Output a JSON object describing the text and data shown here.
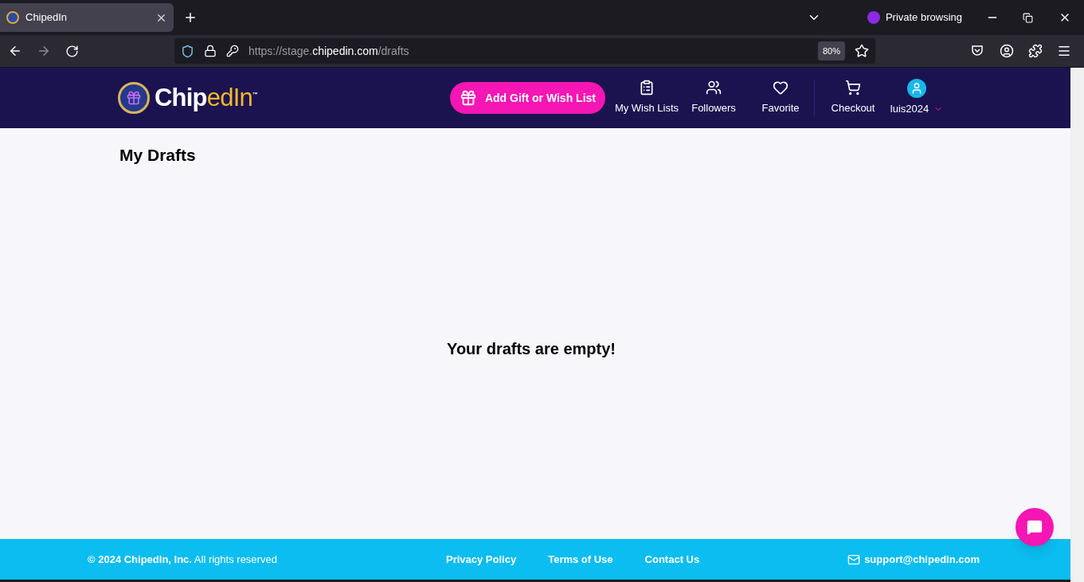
{
  "browser": {
    "tab": {
      "title": "ChipedIn",
      "selected": true
    },
    "private_label": "Private browsing",
    "url": {
      "prefix": "https://stage.",
      "domain": "chipedin.com",
      "path": "/drafts"
    },
    "zoom": "80%"
  },
  "header": {
    "logo": {
      "part1": "Chip",
      "part2": "edIn",
      "mark": "™"
    },
    "add_button": "Add Gift or Wish List",
    "nav": [
      {
        "kind": "wishlist",
        "label": "My Wish Lists"
      },
      {
        "kind": "followers",
        "label": "Followers"
      },
      {
        "kind": "favorite",
        "label": "Favorite"
      },
      {
        "kind": "checkout",
        "label": "Checkout"
      },
      {
        "kind": "user",
        "label": "luis2024"
      }
    ]
  },
  "page": {
    "title": "My Drafts",
    "empty_message": "Your drafts are empty!"
  },
  "footer": {
    "copyright": "**© 2024 ChipedIn, Inc.** All rights reserved",
    "links": [
      "Privacy Policy",
      "Terms of Use",
      "Contact Us"
    ],
    "email": "support@chipedin.com"
  }
}
